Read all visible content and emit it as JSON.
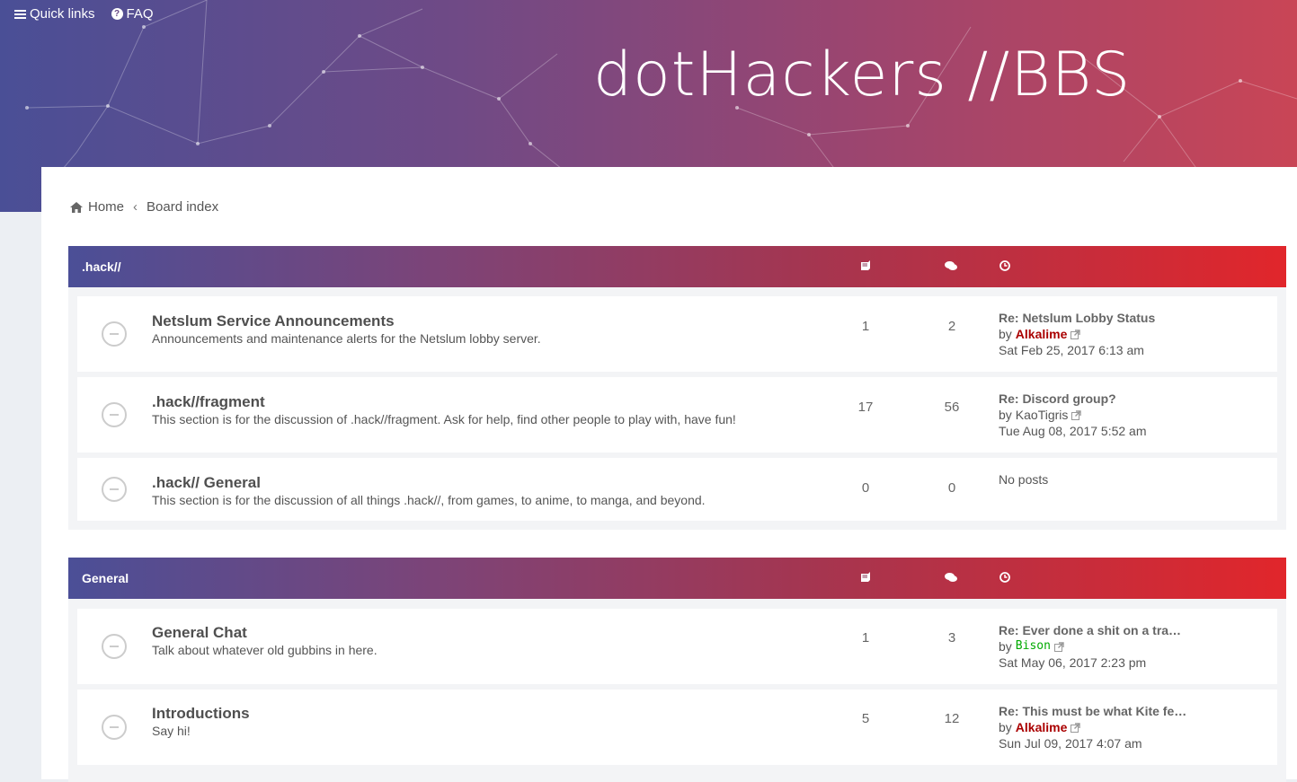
{
  "header": {
    "quick_links": "Quick links",
    "faq": "FAQ",
    "site_title": "dotHackers //BBS"
  },
  "breadcrumb": {
    "home": "Home",
    "board_index": "Board index"
  },
  "categories": [
    {
      "title": ".hack//",
      "forums": [
        {
          "title": "Netslum Service Announcements",
          "desc": "Announcements and maintenance alerts for the Netslum lobby server.",
          "topics": "1",
          "posts": "2",
          "last_title": "Re: Netslum Lobby Status",
          "by": "by",
          "user": "Alkalime",
          "date": "Sat Feb 25, 2017 6:13 am"
        },
        {
          "title": ".hack//fragment",
          "desc": "This section is for the discussion of .hack//fragment. Ask for help, find other people to play with, have fun!",
          "topics": "17",
          "posts": "56",
          "last_title": "Re: Discord group?",
          "by": "by",
          "user": "KaoTigris",
          "date": "Tue Aug 08, 2017 5:52 am"
        },
        {
          "title": ".hack// General",
          "desc": "This section is for the discussion of all things .hack//, from games, to anime, to manga, and beyond.",
          "topics": "0",
          "posts": "0",
          "no_posts": "No posts"
        }
      ]
    },
    {
      "title": "General",
      "forums": [
        {
          "title": "General Chat",
          "desc": "Talk about whatever old gubbins in here.",
          "topics": "1",
          "posts": "3",
          "last_title": "Re: Ever done a shit on a tra…",
          "by": "by",
          "user": "Bison",
          "date": "Sat May 06, 2017 2:23 pm"
        },
        {
          "title": "Introductions",
          "desc": "Say hi!",
          "topics": "5",
          "posts": "12",
          "last_title": "Re: This must be what Kite fe…",
          "by": "by",
          "user": "Alkalime",
          "date": "Sun Jul 09, 2017 4:07 am"
        }
      ]
    }
  ],
  "icons": {
    "topics": "book-icon",
    "posts": "comments-icon",
    "last_post": "clock-icon",
    "view_latest": "external-link-icon",
    "home": "home-icon",
    "menu": "bars-icon",
    "faq": "question-circle-icon"
  },
  "colors": {
    "user_admin": "#aa0000",
    "user_mod": "#00aa00",
    "header_start": "#4b4f97",
    "header_end": "#e1262b"
  }
}
